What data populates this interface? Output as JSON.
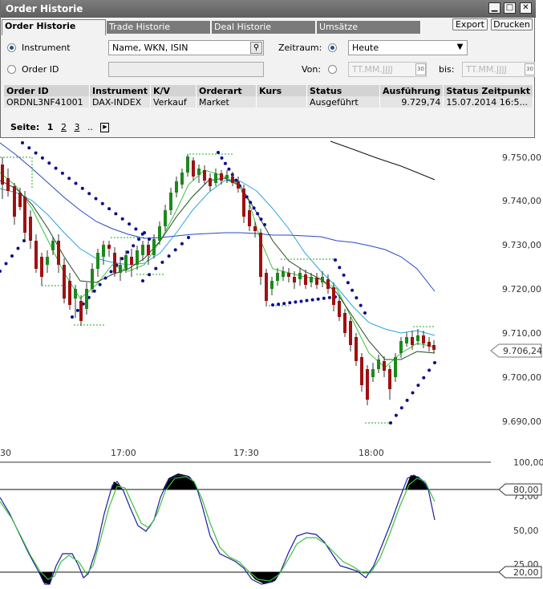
{
  "window": {
    "title": "Order Historie",
    "buttons": {
      "minimize": "minimize-icon",
      "maximize": "maximize-icon",
      "close": "close-icon"
    }
  },
  "tabs": [
    {
      "label": "Order Historie",
      "active": true
    },
    {
      "label": "Trade Historie"
    },
    {
      "label": "Deal Historie"
    },
    {
      "label": "Umsätze"
    }
  ],
  "toolbar": {
    "export_label": "Export",
    "print_label": "Drucken"
  },
  "filters": {
    "instrument_label": "Instrument",
    "instrument_placeholder": "Name, WKN, ISIN",
    "orderid_label": "Order ID",
    "zeitraum_label": "Zeitraum:",
    "zeitraum_value": "Heute",
    "von_label": "Von:",
    "von_placeholder": "TT.MM.JJJJ",
    "bis_label": "bis:",
    "bis_placeholder": "TT.MM.JJJJ",
    "cal_day": "30"
  },
  "table": {
    "columns": [
      "Order ID",
      "Instrument",
      "K/V",
      "Orderart",
      "Kurs",
      "Status",
      "Ausführung",
      "Status Zeitpunkt"
    ],
    "rows": [
      [
        "ORDNL3NF41001",
        "DAX-INDEX",
        "Verkauf",
        "Market",
        "",
        "Ausgeführt",
        "9.729,74",
        "15.07.2014 16:5..."
      ]
    ]
  },
  "pager": {
    "label": "Seite:",
    "pages": [
      "1",
      "2",
      "3"
    ],
    "ellipsis": "..",
    "next_icon": "next-page-icon"
  },
  "chart": {
    "price_ticks": [
      "9.750,00",
      "9.740,00",
      "9.730,00",
      "9.720,00",
      "9.710,00",
      "9.700,00",
      "9.690,00"
    ],
    "time_ticks": [
      "30",
      "17:00",
      "17:30",
      "18:00"
    ],
    "current_price": "9.706,24",
    "osc_ticks": [
      "100,00",
      "75,00",
      "50,00",
      "25,00"
    ],
    "osc_markers": [
      "80,00",
      "20,00"
    ],
    "colors": {
      "up": "#1b8a1b",
      "down": "#a01010",
      "sma_blue": "#2448c8",
      "sma_lightblue": "#2aa3e0",
      "sma_green": "#3ac23a",
      "sma_dark": "#1f4a1f",
      "sar": "#0a0a8c",
      "band": "#22aa22"
    }
  }
}
